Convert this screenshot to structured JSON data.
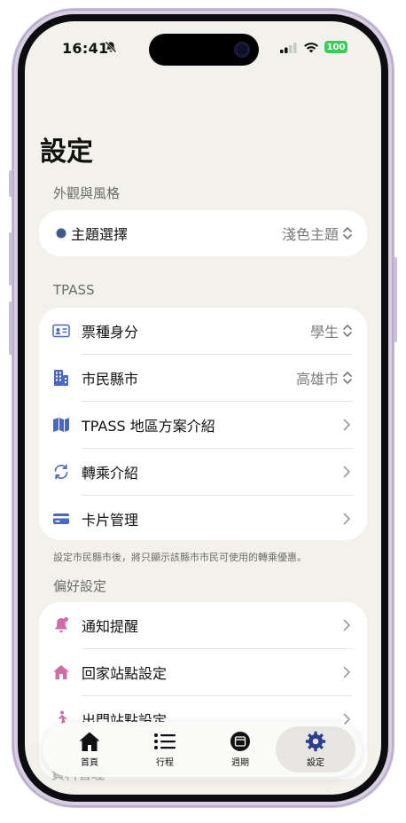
{
  "status_bar": {
    "time": "16:41",
    "battery": "100"
  },
  "page": {
    "title": "設定"
  },
  "appearance": {
    "header": "外觀與風格",
    "theme": {
      "label": "主題選擇",
      "value": "淺色主題"
    }
  },
  "tpass": {
    "header": "TPASS",
    "rows": [
      {
        "label": "票種身分",
        "value": "學生",
        "icon": "id-card-icon"
      },
      {
        "label": "市民縣市",
        "value": "高雄市",
        "icon": "building-icon"
      },
      {
        "label": "TPASS 地區方案介紹",
        "icon": "map-icon"
      },
      {
        "label": "轉乘介紹",
        "icon": "transfer-icon"
      },
      {
        "label": "卡片管理",
        "icon": "credit-card-icon"
      }
    ],
    "footnote": "設定市民縣市後，將只顯示該縣市市民可使用的轉乘優惠。"
  },
  "preferences": {
    "header": "偏好設定",
    "rows": [
      {
        "label": "通知提醒",
        "icon": "bell-icon"
      },
      {
        "label": "回家站點設定",
        "icon": "home-icon"
      },
      {
        "label": "出門站點設定",
        "icon": "walking-icon"
      }
    ]
  },
  "next_section": {
    "header": "資料管理"
  },
  "tabbar": {
    "tabs": [
      {
        "label": "首頁",
        "icon": "home-icon"
      },
      {
        "label": "行程",
        "icon": "list-icon"
      },
      {
        "label": "週期",
        "icon": "calendar-icon"
      },
      {
        "label": "設定",
        "icon": "gear-icon"
      }
    ],
    "active_index": 3
  },
  "colors": {
    "accent": "#4a69bd",
    "pink": "#d16ba5",
    "background": "#f3f1eb",
    "battery": "#3ec95a"
  }
}
